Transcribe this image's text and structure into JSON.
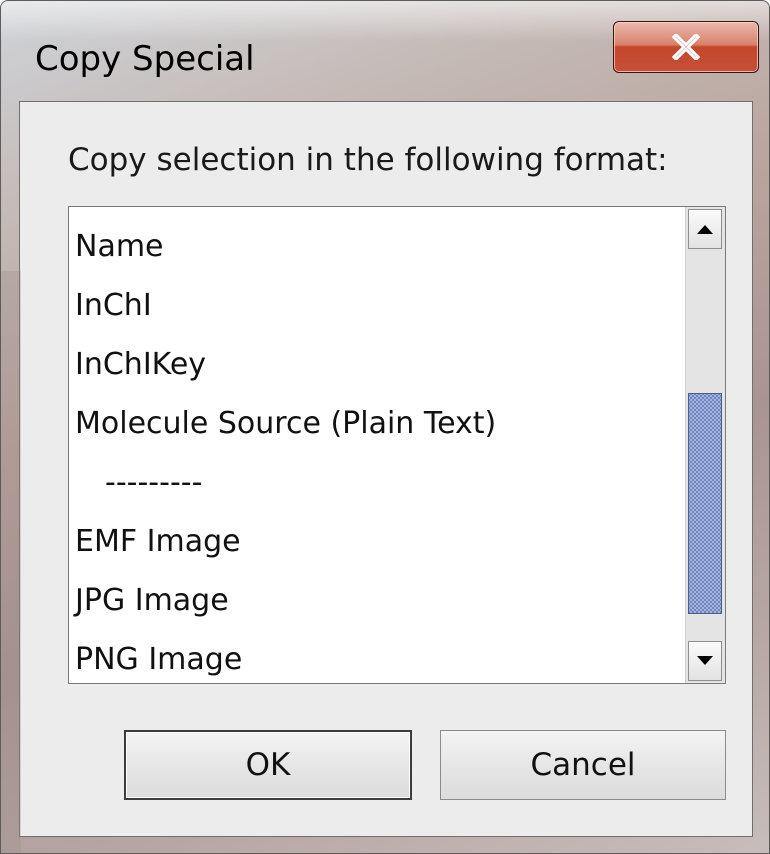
{
  "window": {
    "title": "Copy Special"
  },
  "icons": {
    "close": "close-icon",
    "scroll_up": "arrow-up-icon",
    "scroll_down": "arrow-down-icon"
  },
  "dialog": {
    "prompt": "Copy selection in the following format:",
    "format_list": [
      "Name",
      "InChI",
      "InChIKey",
      "Molecule Source (Plain Text)",
      "---------",
      "EMF Image",
      "JPG Image",
      "PNG Image"
    ],
    "scroll_position": 0.85,
    "scroll_visible_fraction": 0.57,
    "ok_label": "OK",
    "cancel_label": "Cancel"
  },
  "colors": {
    "close_button": "#c4472a",
    "scroll_thumb": "#6f87c1"
  }
}
